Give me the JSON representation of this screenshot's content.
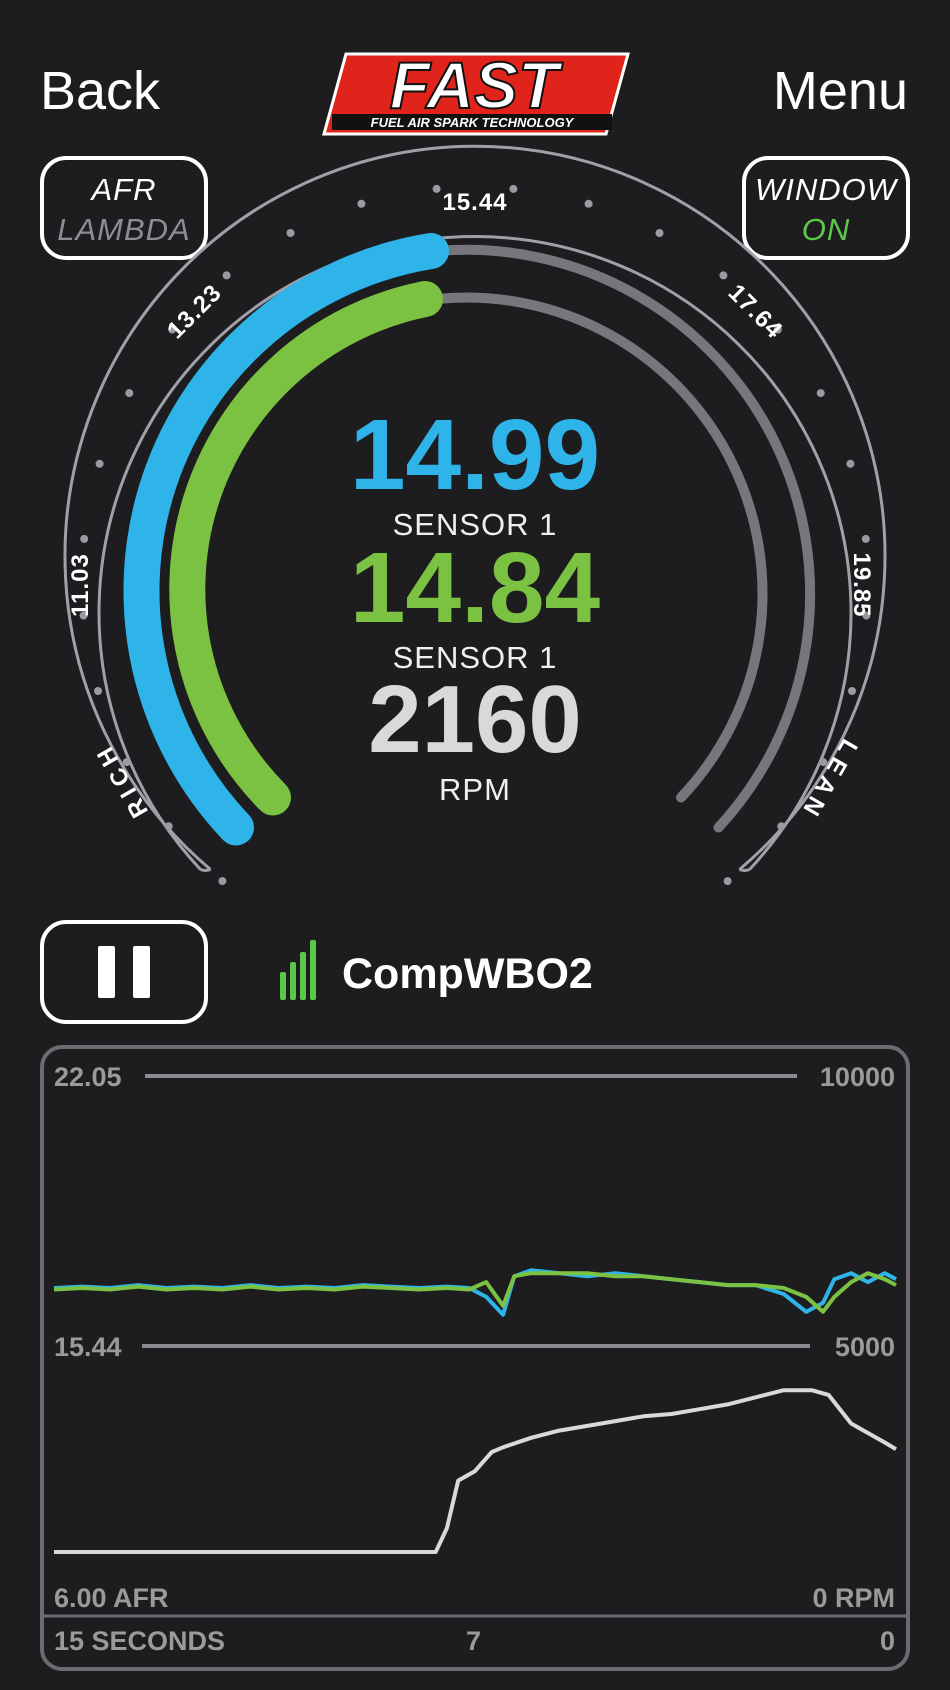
{
  "header": {
    "back_label": "Back",
    "menu_label": "Menu",
    "logo_text": "FAST",
    "logo_subtext": "FUEL AIR SPARK TECHNOLOGY"
  },
  "mode_button": {
    "line1": "AFR",
    "line2": "LAMBDA"
  },
  "window_button": {
    "line1": "WINDOW",
    "line2": "ON"
  },
  "gauge": {
    "scale_labels": [
      "11.03",
      "13.23",
      "15.44",
      "17.64",
      "19.85"
    ],
    "rich_label": "RICH",
    "lean_label": "LEAN",
    "sensor_a_value": "14.99",
    "sensor_a_label": "SENSOR 1",
    "sensor_b_value": "14.84",
    "sensor_b_label": "SENSOR 1",
    "rpm_value": "2160",
    "rpm_label": "RPM"
  },
  "controls": {
    "device_name": "CompWBO2"
  },
  "history_chart": {
    "left_top": "22.05",
    "right_top": "10000",
    "left_mid": "15.44",
    "right_mid": "5000",
    "left_bottom": "6.00 AFR",
    "right_bottom": "0 RPM",
    "time_start": "15 SECONDS",
    "time_mid": "7",
    "time_end": "0"
  },
  "colors": {
    "background": "#1d1d1f",
    "sensor_a": "#2fb4e9",
    "sensor_b": "#7cc242",
    "rpm": "#d9d9d9",
    "track": "#77767d",
    "window_on": "#5cc84a",
    "logo_red": "#e0241b"
  },
  "icons": {
    "pause": "pause-icon",
    "signal": "signal-bars-icon"
  },
  "chart_data": {
    "type": "line",
    "x_label": "SECONDS",
    "x_range": [
      15,
      0
    ],
    "y_left_range": [
      6.0,
      22.05
    ],
    "y_right_range": [
      0,
      10000
    ],
    "series": [
      {
        "color": "#2fb4e9",
        "axis": "left",
        "x": [
          15,
          14.5,
          14,
          13.5,
          13,
          12.5,
          12,
          11.5,
          11,
          10.5,
          10,
          9.5,
          9,
          8.5,
          8,
          7.6,
          7.3,
          7.0,
          6.8,
          6.5,
          6,
          5.5,
          5,
          4.5,
          4,
          3.5,
          3,
          2.5,
          2,
          1.6,
          1.3,
          1.1,
          0.8,
          0.5,
          0.2,
          0
        ],
        "y": [
          14.9,
          14.95,
          14.9,
          15.0,
          14.9,
          14.95,
          14.9,
          15.0,
          14.9,
          14.95,
          14.9,
          15.0,
          14.95,
          14.9,
          14.95,
          14.9,
          14.6,
          14.0,
          15.3,
          15.5,
          15.4,
          15.3,
          15.4,
          15.3,
          15.2,
          15.1,
          15.0,
          15.0,
          14.7,
          14.1,
          14.4,
          15.2,
          15.4,
          15.1,
          15.4,
          15.2
        ]
      },
      {
        "color": "#7cc242",
        "axis": "left",
        "x": [
          15,
          14.5,
          14,
          13.5,
          13,
          12.5,
          12,
          11.5,
          11,
          10.5,
          10,
          9.5,
          9,
          8.5,
          8,
          7.6,
          7.3,
          7.0,
          6.8,
          6.5,
          6,
          5.5,
          5,
          4.5,
          4,
          3.5,
          3,
          2.5,
          2,
          1.6,
          1.3,
          1.1,
          0.8,
          0.5,
          0.2,
          0
        ],
        "y": [
          14.85,
          14.9,
          14.85,
          14.95,
          14.85,
          14.9,
          14.85,
          14.95,
          14.85,
          14.9,
          14.85,
          14.95,
          14.9,
          14.85,
          14.9,
          14.85,
          15.1,
          14.3,
          15.3,
          15.4,
          15.4,
          15.4,
          15.3,
          15.3,
          15.2,
          15.1,
          15.0,
          15.0,
          14.9,
          14.6,
          14.1,
          14.6,
          15.1,
          15.4,
          15.2,
          15.0
        ]
      },
      {
        "color": "#d9d9d9",
        "axis": "right",
        "x": [
          15,
          14,
          13,
          12,
          11,
          10,
          9,
          8.2,
          8.0,
          7.8,
          7.5,
          7.2,
          7,
          6.5,
          6,
          5.5,
          5,
          4.5,
          4,
          3.5,
          3,
          2.5,
          2,
          1.5,
          1.2,
          1.0,
          0.8,
          0.5,
          0.2,
          0
        ],
        "y": [
          0,
          0,
          0,
          0,
          0,
          0,
          0,
          0,
          500,
          1500,
          1700,
          2100,
          2200,
          2400,
          2550,
          2650,
          2750,
          2850,
          2900,
          3000,
          3100,
          3250,
          3400,
          3400,
          3300,
          3000,
          2700,
          2500,
          2300,
          2160
        ]
      }
    ]
  }
}
